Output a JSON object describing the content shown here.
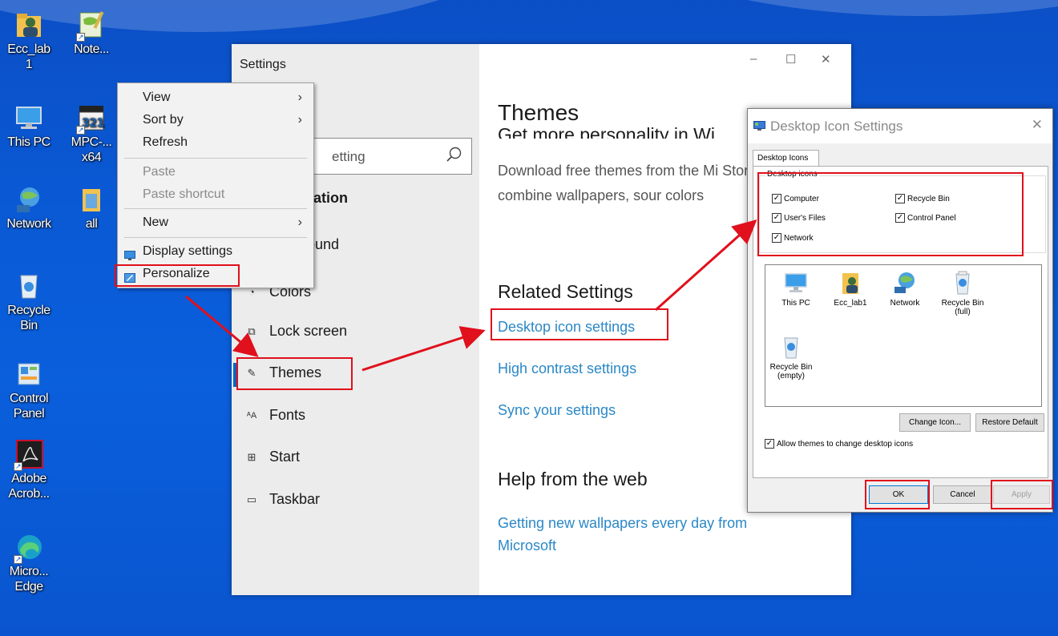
{
  "desktop": {
    "icons": [
      {
        "label": "Ecc_lab 1",
        "name": "folder-user-icon"
      },
      {
        "label": "Note...",
        "name": "notepad-plus-icon"
      },
      {
        "label": "This PC",
        "name": "this-pc-icon"
      },
      {
        "label": "MPC-... x64",
        "name": "mpc-player-icon"
      },
      {
        "label": "Network",
        "name": "network-icon"
      },
      {
        "label": "all",
        "name": "folder-icon"
      },
      {
        "label": "Recycle Bin",
        "name": "recycle-bin-icon"
      },
      {
        "label": "Control Panel",
        "name": "control-panel-icon"
      },
      {
        "label": "Adobe Acrob...",
        "name": "adobe-acrobat-icon"
      },
      {
        "label": "Micro... Edge",
        "name": "edge-icon"
      }
    ]
  },
  "context_menu": {
    "view": "View",
    "sort_by": "Sort by",
    "refresh": "Refresh",
    "paste": "Paste",
    "paste_shortcut": "Paste shortcut",
    "new": "New",
    "display_settings": "Display settings",
    "personalize": "Personalize",
    "submenu_arrow": "›"
  },
  "settings": {
    "window_title": "Settings",
    "search_placeholder": "etting",
    "section_heading": "zation",
    "nav": [
      {
        "label": "round",
        "icon": "background-icon"
      },
      {
        "label": "Colors",
        "icon": "colors-icon"
      },
      {
        "label": "Lock screen",
        "icon": "lock-screen-icon"
      },
      {
        "label": "Themes",
        "icon": "themes-icon"
      },
      {
        "label": "Fonts",
        "icon": "fonts-icon"
      },
      {
        "label": "Start",
        "icon": "start-icon"
      },
      {
        "label": "Taskbar",
        "icon": "taskbar-icon"
      }
    ],
    "content": {
      "title": "Themes",
      "subtitle": "Get more personality in Wi",
      "description": "Download free themes from the Mi Store that combine wallpapers, sour colors",
      "related_heading": "Related Settings",
      "link_desktop_icons": "Desktop icon settings",
      "link_high_contrast": "High contrast settings",
      "link_sync": "Sync your settings",
      "help_heading": "Help from the web",
      "link_wallpapers": "Getting new wallpapers every day from Microsoft"
    },
    "controls": {
      "minimize": "–",
      "maximize": "☐",
      "close": "✕"
    }
  },
  "dialog": {
    "title": "Desktop Icon Settings",
    "close": "✕",
    "tab": "Desktop Icons",
    "group_title": "Desktop icons",
    "checkboxes": {
      "computer": "Computer",
      "recycle_bin": "Recycle Bin",
      "users_files": "User's Files",
      "control_panel": "Control Panel",
      "network": "Network",
      "check": "✓"
    },
    "icons": [
      {
        "label": "This PC"
      },
      {
        "label": "Ecc_lab1"
      },
      {
        "label": "Network"
      },
      {
        "label": "Recycle Bin (full)"
      },
      {
        "label": "Recycle Bin (empty)"
      }
    ],
    "change_icon": "Change Icon...",
    "restore_default": "Restore Default",
    "allow_themes": "Allow themes to change desktop icons",
    "ok": "OK",
    "cancel": "Cancel",
    "apply": "Apply"
  },
  "colors": {
    "highlight": "#e0101c",
    "link": "#2b88c7",
    "desktop": "#0a5ad6"
  }
}
